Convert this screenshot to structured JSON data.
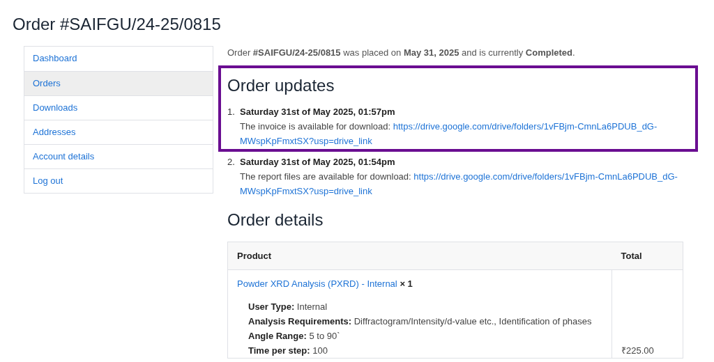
{
  "page_title": "Order #SAIFGU/24-25/0815",
  "sidebar": {
    "items": [
      {
        "label": "Dashboard",
        "selected": false
      },
      {
        "label": "Orders",
        "selected": true
      },
      {
        "label": "Downloads",
        "selected": false
      },
      {
        "label": "Addresses",
        "selected": false
      },
      {
        "label": "Account details",
        "selected": false
      },
      {
        "label": "Log out",
        "selected": false
      }
    ]
  },
  "summary": "Order **#SAIFGU/24-25/0815** was placed on **May 31, 2025** and is currently **Completed**.",
  "order_updates": {
    "title": "Order updates",
    "items": [
      {
        "number": "1.",
        "highlighted": true,
        "date": "Saturday 31st of May 2025, 01:57pm",
        "text": "The invoice is available for download:",
        "link_lines": [
          "https://drive.google.com/drive/folders/1vFBjm-CmnLa6PDUB_dG-",
          "MWspKpFmxtSX?usp=drive_link"
        ]
      },
      {
        "number": "2.",
        "highlighted": false,
        "date": "Saturday 31st of May 2025, 01:54pm",
        "text": "The report files are available for download:",
        "link_lines": [
          "https://drive.google.com/drive/folders/1vFBjm-CmnLa6PDUB_dG-",
          "MWspKpFmxtSX?usp=drive_link"
        ]
      }
    ]
  },
  "order_details": {
    "title": "Order details",
    "columns": [
      "Product",
      "Total"
    ],
    "rows": [
      {
        "product": "Powder XRD Analysis (PXRD) - Internal",
        "quantity": "× 1",
        "meta": [
          {
            "key": "User Type:",
            "value": "Internal"
          },
          {
            "key": "Analysis Requirements:",
            "value": "Diffractogram/Intensity/d-value etc., Identification of phases"
          },
          {
            "key": "Angle Range:",
            "value": "5 to 90`"
          },
          {
            "key": "Time per step:",
            "value": "100"
          }
        ],
        "total": "₹225.00"
      }
    ]
  }
}
